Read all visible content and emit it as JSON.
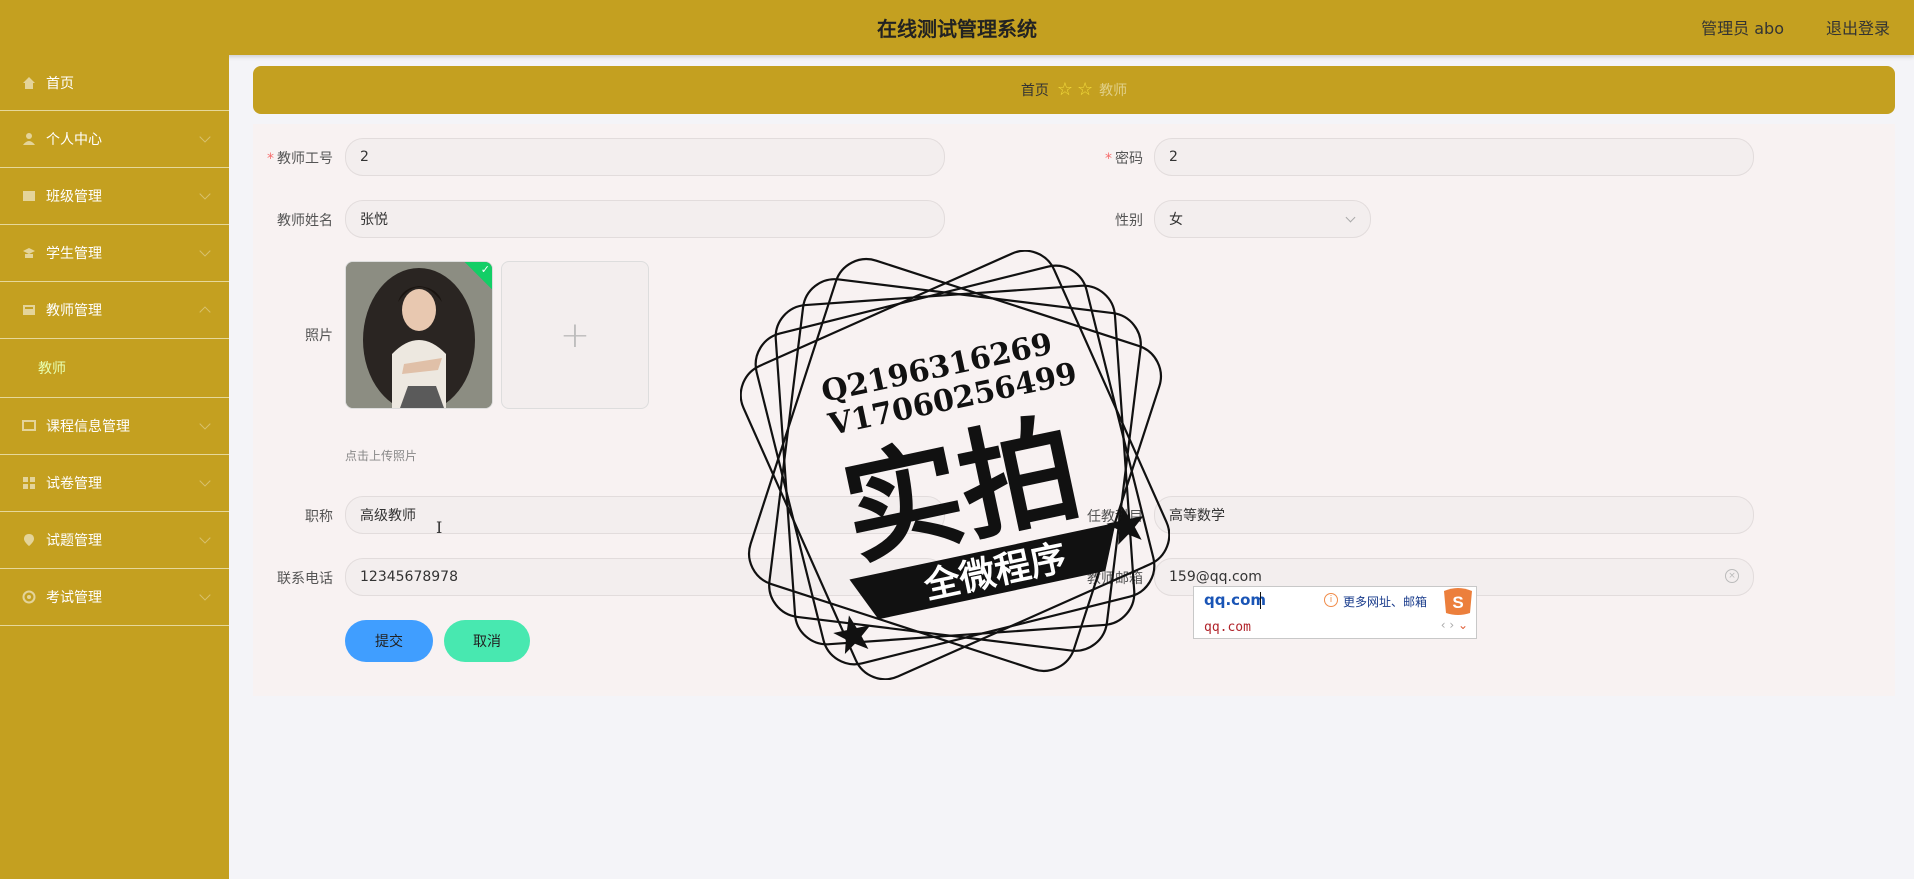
{
  "header": {
    "title": "在线测试管理系统",
    "admin": "管理员 abo",
    "logout": "退出登录"
  },
  "sidebar": {
    "items": [
      {
        "label": "首页",
        "icon": "home-icon"
      },
      {
        "label": "个人中心",
        "icon": "user-icon"
      },
      {
        "label": "班级管理",
        "icon": "class-icon"
      },
      {
        "label": "学生管理",
        "icon": "student-icon"
      },
      {
        "label": "教师管理",
        "icon": "teacher-icon"
      },
      {
        "label": "课程信息管理",
        "icon": "course-icon"
      },
      {
        "label": "试卷管理",
        "icon": "paper-icon"
      },
      {
        "label": "试题管理",
        "icon": "question-icon"
      },
      {
        "label": "考试管理",
        "icon": "exam-icon"
      }
    ],
    "sub_teacher": "教师"
  },
  "breadcrumb": {
    "home": "首页",
    "current": "教师"
  },
  "form": {
    "teacher_id_label": "教师工号",
    "teacher_id_value": "2",
    "password_label": "密码",
    "password_value": "2",
    "name_label": "教师姓名",
    "name_value": "张悦",
    "gender_label": "性别",
    "gender_value": "女",
    "photo_label": "照片",
    "upload_hint": "点击上传照片",
    "title_label": "职称",
    "title_value": "高级教师",
    "subject_label": "任教科目",
    "subject_value": "高等数学",
    "phone_label": "联系电话",
    "phone_value": "12345678978",
    "email_label": "教师邮箱",
    "email_value": "159@qq.com",
    "submit": "提交",
    "cancel": "取消"
  },
  "ime_popup": {
    "input": "qq.com",
    "info": "更多网址、邮箱",
    "candidate": "qq.com"
  },
  "watermark": {
    "line1": "Q2196316269",
    "line2": "V17060256499",
    "big": "实拍",
    "banner": "全微程序"
  },
  "colors": {
    "theme": "#c4a020",
    "submit": "#409eff",
    "cancel": "#48e8b0"
  }
}
